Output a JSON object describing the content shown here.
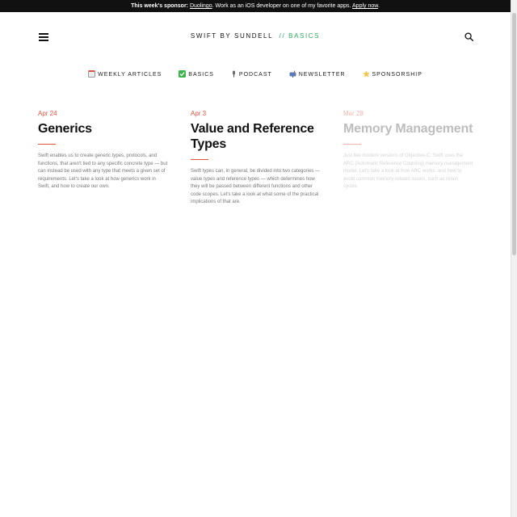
{
  "sponsor": {
    "lead": "This week's sponsor:",
    "name": "Duolingo",
    "text": ". Work as an iOS developer on one of my favorite apps.",
    "cta": "Apply now",
    "end": "."
  },
  "header": {
    "brand": "SWIFT BY SUNDELL",
    "separator": "//",
    "section": "BASICS"
  },
  "nav": [
    {
      "icon": "calendar-icon",
      "label": "WEEKLY ARTICLES"
    },
    {
      "icon": "checkmark-icon",
      "label": "BASICS"
    },
    {
      "icon": "microphone-icon",
      "label": "PODCAST"
    },
    {
      "icon": "mailbox-icon",
      "label": "NEWSLETTER"
    },
    {
      "icon": "star-icon",
      "label": "SPONSORSHIP"
    }
  ],
  "articles": [
    {
      "date": "Apr 24",
      "title": "Generics",
      "description": "Swift enables us to create generic types, protocols, and functions, that aren't tied to any specific concrete type — but can instead be used with any type that meets a given set of requirements. Let's take a look at how generics work in Swift, and how to create our own."
    },
    {
      "date": "Apr 3",
      "title": "Value and Reference Types",
      "description": "Swift types can, in general, be divided into two categories — value types and reference types — which determines how they will be passed between different functions and other code scopes. Let's take a look at what some of the practical implications of that are."
    },
    {
      "date": "Mar 28",
      "title": "Memory Management",
      "description": "Just like modern versions of Objective-C, Swift uses the ARC (Automatic Reference Counting) memory management model. Let's take a look at how ARC works, and how to avoid common memory-related issues, such as retain cycles."
    }
  ],
  "colors": {
    "accent": "#e8533f",
    "brand_green": "#27ae60",
    "sponsor_bg": "#111111"
  }
}
